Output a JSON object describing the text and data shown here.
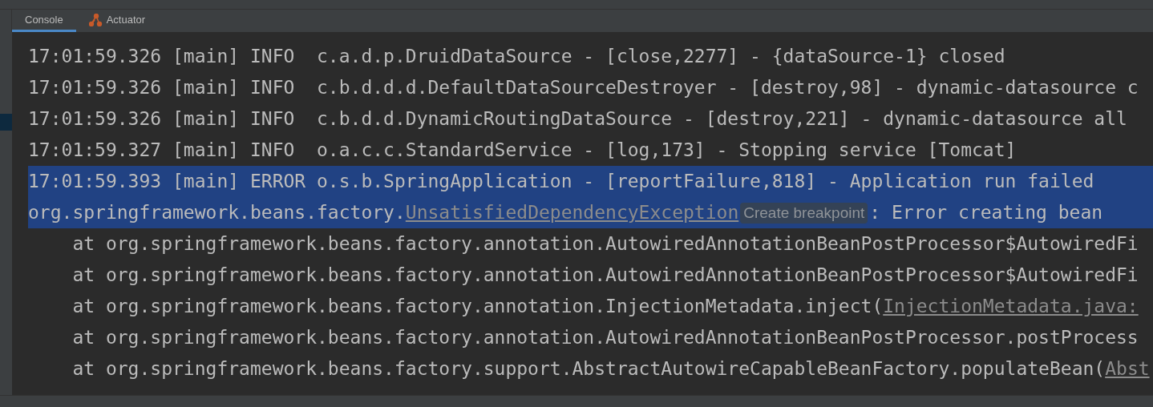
{
  "tabs": [
    {
      "label": "Console",
      "selected": true,
      "kind": "plain"
    },
    {
      "label": "Actuator",
      "selected": false,
      "kind": "actuator"
    }
  ],
  "lines": [
    {
      "selected": false,
      "segments": [
        {
          "kind": "plain",
          "text": "17:01:59.326 [main] INFO  c.a.d.p.DruidDataSource - [close,2277] - {dataSource-1} closed"
        }
      ]
    },
    {
      "selected": false,
      "segments": [
        {
          "kind": "plain",
          "text": "17:01:59.326 [main] INFO  c.b.d.d.d.DefaultDataSourceDestroyer - [destroy,98] - dynamic-datasource c"
        }
      ]
    },
    {
      "selected": false,
      "segments": [
        {
          "kind": "plain",
          "text": "17:01:59.326 [main] INFO  c.b.d.d.DynamicRoutingDataSource - [destroy,221] - dynamic-datasource all"
        }
      ]
    },
    {
      "selected": false,
      "segments": [
        {
          "kind": "plain",
          "text": "17:01:59.327 [main] INFO  o.a.c.c.StandardService - [log,173] - Stopping service [Tomcat]"
        }
      ]
    },
    {
      "selected": true,
      "segments": [
        {
          "kind": "plain",
          "text": "17:01:59.393 [main] ERROR o.s.b.SpringApplication - [reportFailure,818] - Application run failed"
        }
      ]
    },
    {
      "selected": true,
      "segments": [
        {
          "kind": "plain",
          "text": "org.springframework.beans.factory."
        },
        {
          "kind": "link",
          "text": "UnsatisfiedDependencyException"
        },
        {
          "kind": "hint",
          "text": "Create breakpoint"
        },
        {
          "kind": "plain",
          "text": ": Error creating bean"
        }
      ]
    },
    {
      "selected": false,
      "segments": [
        {
          "kind": "plain",
          "text": "    at org.springframework.beans.factory.annotation.AutowiredAnnotationBeanPostProcessor$AutowiredFi"
        }
      ]
    },
    {
      "selected": false,
      "segments": [
        {
          "kind": "plain",
          "text": "    at org.springframework.beans.factory.annotation.AutowiredAnnotationBeanPostProcessor$AutowiredFi"
        }
      ]
    },
    {
      "selected": false,
      "segments": [
        {
          "kind": "plain",
          "text": "    at org.springframework.beans.factory.annotation.InjectionMetadata.inject("
        },
        {
          "kind": "link",
          "text": "InjectionMetadata.java:"
        }
      ]
    },
    {
      "selected": false,
      "segments": [
        {
          "kind": "plain",
          "text": "    at org.springframework.beans.factory.annotation.AutowiredAnnotationBeanPostProcessor.postProcess"
        }
      ]
    },
    {
      "selected": false,
      "segments": [
        {
          "kind": "plain",
          "text": "    at org.springframework.beans.factory.support.AbstractAutowireCapableBeanFactory.populateBean("
        },
        {
          "kind": "link",
          "text": "Abst"
        }
      ]
    }
  ]
}
